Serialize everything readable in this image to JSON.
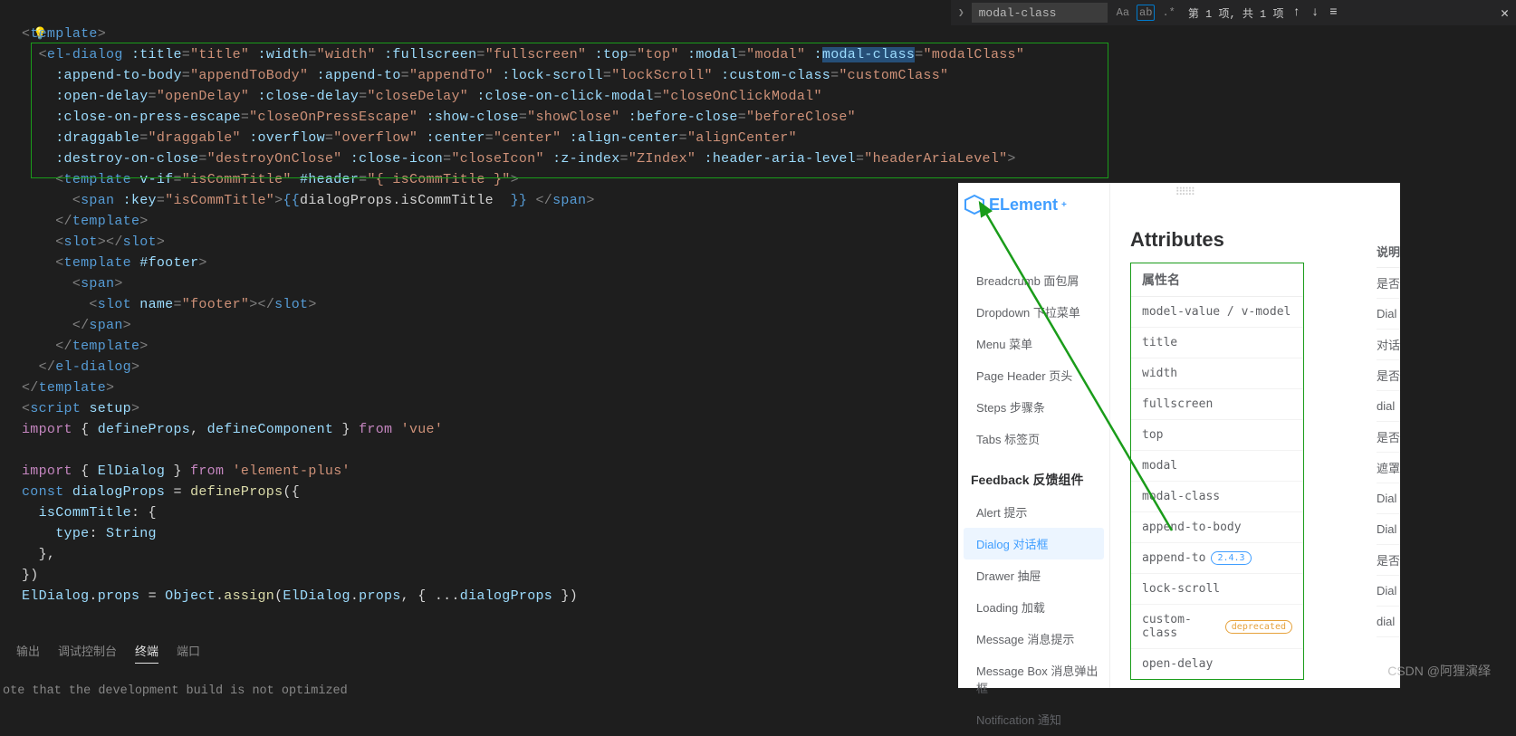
{
  "search": {
    "value": "modal-class",
    "result": "第 1 项, 共 1 项",
    "icons": {
      "case": "Aa",
      "word": "ab",
      "regex": ".*"
    }
  },
  "code": {
    "lines": [
      {
        "html": "<span class='t-tag'>&lt;</span><span class='t-elem'>template</span><span class='t-tag'>&gt;</span>"
      },
      {
        "html": "  <span class='t-tag'>&lt;</span><span class='t-elem'>el-dialog</span> <span class='t-attr'>:title</span><span class='t-punct'>=</span><span class='t-str'>\"title\"</span> <span class='t-attr'>:width</span><span class='t-punct'>=</span><span class='t-str'>\"width\"</span> <span class='t-attr'>:fullscreen</span><span class='t-punct'>=</span><span class='t-str'>\"fullscreen\"</span> <span class='t-attr'>:top</span><span class='t-punct'>=</span><span class='t-str'>\"top\"</span> <span class='t-attr'>:modal</span><span class='t-punct'>=</span><span class='t-str'>\"modal\"</span> <span class='t-attr'>:</span><span class='highlight-sel t-attr'>modal-class</span><span class='t-punct'>=</span><span class='t-str'>\"modalClass\"</span>"
      },
      {
        "html": "    <span class='t-attr'>:append-to-body</span><span class='t-punct'>=</span><span class='t-str'>\"appendToBody\"</span> <span class='t-attr'>:append-to</span><span class='t-punct'>=</span><span class='t-str'>\"appendTo\"</span> <span class='t-attr'>:lock-scroll</span><span class='t-punct'>=</span><span class='t-str'>\"lockScroll\"</span> <span class='t-attr'>:custom-class</span><span class='t-punct'>=</span><span class='t-str'>\"customClass\"</span>"
      },
      {
        "html": "    <span class='t-attr'>:open-delay</span><span class='t-punct'>=</span><span class='t-str'>\"openDelay\"</span> <span class='t-attr'>:close-delay</span><span class='t-punct'>=</span><span class='t-str'>\"closeDelay\"</span> <span class='t-attr'>:close-on-click-modal</span><span class='t-punct'>=</span><span class='t-str'>\"closeOnClickModal\"</span>"
      },
      {
        "html": "    <span class='t-attr'>:close-on-press-escape</span><span class='t-punct'>=</span><span class='t-str'>\"closeOnPressEscape\"</span> <span class='t-attr'>:show-close</span><span class='t-punct'>=</span><span class='t-str'>\"showClose\"</span> <span class='t-attr'>:before-close</span><span class='t-punct'>=</span><span class='t-str'>\"beforeClose\"</span>"
      },
      {
        "html": "    <span class='t-attr'>:draggable</span><span class='t-punct'>=</span><span class='t-str'>\"draggable\"</span> <span class='t-attr'>:overflow</span><span class='t-punct'>=</span><span class='t-str'>\"overflow\"</span> <span class='t-attr'>:center</span><span class='t-punct'>=</span><span class='t-str'>\"center\"</span> <span class='t-attr'>:align-center</span><span class='t-punct'>=</span><span class='t-str'>\"alignCenter\"</span>"
      },
      {
        "html": "    <span class='t-attr'>:destroy-on-close</span><span class='t-punct'>=</span><span class='t-str'>\"destroyOnClose\"</span> <span class='t-attr'>:close-icon</span><span class='t-punct'>=</span><span class='t-str'>\"closeIcon\"</span> <span class='t-attr'>:z-index</span><span class='t-punct'>=</span><span class='t-str'>\"ZIndex\"</span> <span class='t-attr'>:header-aria-level</span><span class='t-punct'>=</span><span class='t-str'>\"headerAriaLevel\"</span><span class='t-tag'>&gt;</span>"
      },
      {
        "html": "    <span class='t-tag'>&lt;</span><span class='t-elem'>template</span> <span class='t-attr'>v-if</span><span class='t-punct'>=</span><span class='t-str'>\"isCommTitle\"</span> <span class='t-attr'>#header</span><span class='t-punct'>=</span><span class='t-str'>\"{ isCommTitle }\"</span><span class='t-tag'>&gt;</span>"
      },
      {
        "html": "      <span class='t-tag'>&lt;</span><span class='t-elem'>span</span> <span class='t-attr'>:key</span><span class='t-punct'>=</span><span class='t-str'>\"isCommTitle\"</span><span class='t-tag'>&gt;</span><span class='t-curly'>{{</span><span class='t-default'>dialogProps.isCommTitle  </span><span class='t-curly'>}}</span> <span class='t-tag'>&lt;/</span><span class='t-elem'>span</span><span class='t-tag'>&gt;</span>"
      },
      {
        "html": "    <span class='t-tag'>&lt;/</span><span class='t-elem'>template</span><span class='t-tag'>&gt;</span>"
      },
      {
        "html": "    <span class='t-tag'>&lt;</span><span class='t-elem'>slot</span><span class='t-tag'>&gt;&lt;/</span><span class='t-elem'>slot</span><span class='t-tag'>&gt;</span>"
      },
      {
        "html": "    <span class='t-tag'>&lt;</span><span class='t-elem'>template</span> <span class='t-attr'>#footer</span><span class='t-tag'>&gt;</span>"
      },
      {
        "html": "      <span class='t-tag'>&lt;</span><span class='t-elem'>span</span><span class='t-tag'>&gt;</span>"
      },
      {
        "html": "        <span class='t-tag'>&lt;</span><span class='t-elem'>slot</span> <span class='t-attr'>name</span><span class='t-punct'>=</span><span class='t-str'>\"footer\"</span><span class='t-tag'>&gt;&lt;/</span><span class='t-elem'>slot</span><span class='t-tag'>&gt;</span>"
      },
      {
        "html": "      <span class='t-tag'>&lt;/</span><span class='t-elem'>span</span><span class='t-tag'>&gt;</span>"
      },
      {
        "html": "    <span class='t-tag'>&lt;/</span><span class='t-elem'>template</span><span class='t-tag'>&gt;</span>"
      },
      {
        "html": "  <span class='t-tag'>&lt;/</span><span class='t-elem'>el-dialog</span><span class='t-tag'>&gt;</span>"
      },
      {
        "html": "<span class='t-tag'>&lt;/</span><span class='t-elem'>template</span><span class='t-tag'>&gt;</span>"
      },
      {
        "html": "<span class='t-tag'>&lt;</span><span class='t-elem'>script</span> <span class='t-attr'>setup</span><span class='t-tag'>&gt;</span>"
      },
      {
        "html": "<span class='t-keyword'>import</span> <span class='t-default'>{ </span><span class='t-var'>defineProps</span><span class='t-default'>, </span><span class='t-var'>defineComponent</span><span class='t-default'> }</span> <span class='t-keyword'>from</span> <span class='t-str'>'vue'</span>"
      },
      {
        "html": ""
      },
      {
        "html": "<span class='t-keyword'>import</span> <span class='t-default'>{ </span><span class='t-var'>ElDialog</span><span class='t-default'> }</span> <span class='t-keyword'>from</span> <span class='t-str'>'element-plus'</span>"
      },
      {
        "html": "<span class='t-elem'>const</span> <span class='t-var'>dialogProps</span> <span class='t-default'>= </span><span class='t-func'>defineProps</span><span class='t-default'>({</span>"
      },
      {
        "html": "  <span class='t-var'>isCommTitle</span><span class='t-default'>: {</span>"
      },
      {
        "html": "    <span class='t-var'>type</span><span class='t-default'>: </span><span class='t-var'>String</span>"
      },
      {
        "html": "  <span class='t-default'>},</span>"
      },
      {
        "html": "<span class='t-default'>})</span>"
      },
      {
        "html": "<span class='t-var'>ElDialog</span><span class='t-default'>.</span><span class='t-var'>props</span> <span class='t-default'>= </span><span class='t-var'>Object</span><span class='t-default'>.</span><span class='t-func'>assign</span><span class='t-default'>(</span><span class='t-var'>ElDialog</span><span class='t-default'>.</span><span class='t-var'>props</span><span class='t-default'>, { ...</span><span class='t-var'>dialogProps</span><span class='t-default'> })</span>"
      }
    ]
  },
  "tabs": {
    "output": "输出",
    "debug": "调试控制台",
    "terminal": "终端",
    "port": "端口"
  },
  "terminal_msg": "ote that the development build is not optimized",
  "doc": {
    "logo": "ELement",
    "title": "Attributes",
    "col_name_header": "属性名",
    "col_desc_header": "说明",
    "nav": [
      {
        "label": "Breadcrumb 面包屑",
        "active": false
      },
      {
        "label": "Dropdown 下拉菜单",
        "active": false
      },
      {
        "label": "Menu 菜单",
        "active": false
      },
      {
        "label": "Page Header 页头",
        "active": false
      },
      {
        "label": "Steps 步骤条",
        "active": false
      },
      {
        "label": "Tabs 标签页",
        "active": false
      }
    ],
    "nav_heading": "Feedback 反馈组件",
    "nav2": [
      {
        "label": "Alert 提示",
        "active": false
      },
      {
        "label": "Dialog 对话框",
        "active": true
      },
      {
        "label": "Drawer 抽屉",
        "active": false
      },
      {
        "label": "Loading 加载",
        "active": false
      },
      {
        "label": "Message 消息提示",
        "active": false
      },
      {
        "label": "Message Box 消息弹出框",
        "active": false
      },
      {
        "label": "Notification 通知",
        "active": false
      }
    ],
    "attrs": [
      {
        "name": "model-value / v-model",
        "desc": "是否"
      },
      {
        "name": "title",
        "desc": "Dial slot"
      },
      {
        "name": "width",
        "desc": "对话"
      },
      {
        "name": "fullscreen",
        "desc": "是否"
      },
      {
        "name": "top",
        "desc": "dial"
      },
      {
        "name": "modal",
        "desc": "是否"
      },
      {
        "name": "modal-class",
        "desc": "遮罩"
      },
      {
        "name": "append-to-body",
        "desc": "Dial Dial"
      },
      {
        "name": "append-to",
        "badge": "2.4.3",
        "badge_type": "ver",
        "desc": "Dial ap"
      },
      {
        "name": "lock-scroll",
        "desc": "是否"
      },
      {
        "name": "custom-class",
        "badge": "deprecated",
        "badge_type": "dep",
        "desc": "Dial"
      },
      {
        "name": "open-delay",
        "desc": "dial"
      }
    ]
  },
  "watermark": "CSDN @阿狸演绎"
}
